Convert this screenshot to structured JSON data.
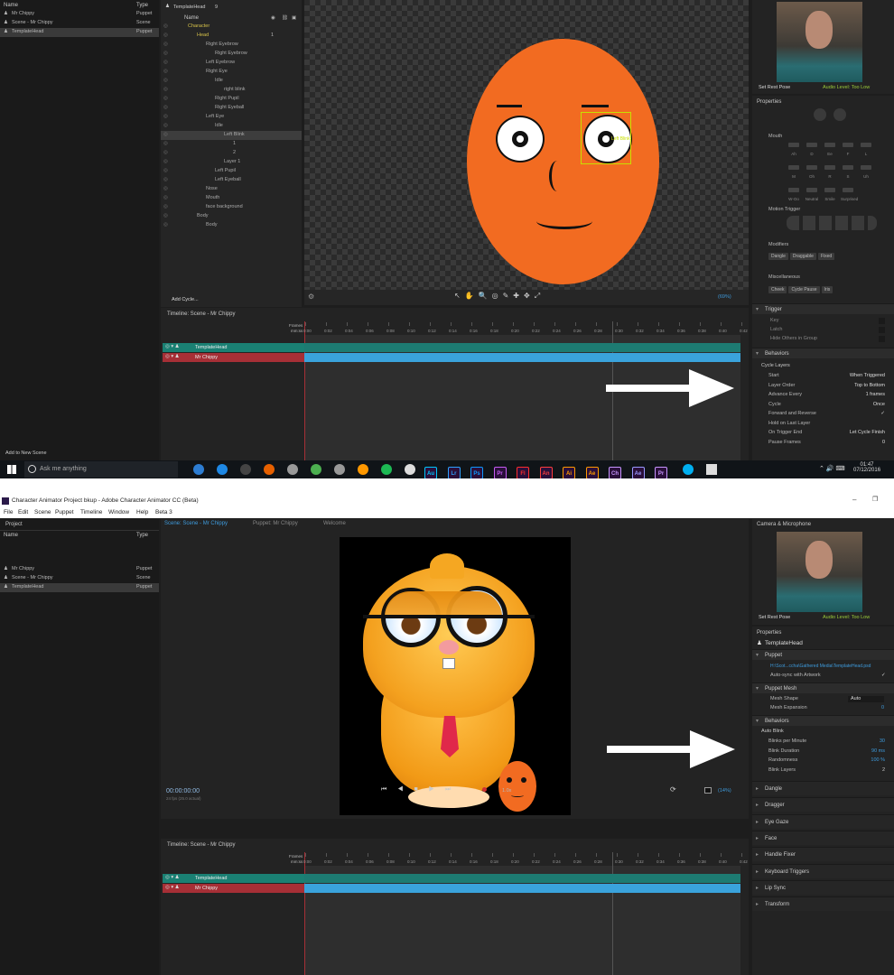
{
  "top": {
    "project": {
      "col_name": "Name",
      "col_type": "Type",
      "items": [
        {
          "name": "Mr Chippy",
          "type": "Puppet"
        },
        {
          "name": "Scene - Mr Chippy",
          "type": "Scene"
        },
        {
          "name": "TemplateHead",
          "type": "Puppet"
        }
      ],
      "add_scene": "Add to New Scene"
    },
    "layers": {
      "header_name": "TemplateHead",
      "header_count": "9",
      "col_name": "Name",
      "add_cycle": "Add Cycle...",
      "items": [
        {
          "label": "Character"
        },
        {
          "label": "Head",
          "num": "1"
        },
        {
          "label": "Right Eyebrow"
        },
        {
          "label": "Right Eyebrow"
        },
        {
          "label": "Left Eyebrow"
        },
        {
          "label": "Right Eye"
        },
        {
          "label": "Idle"
        },
        {
          "label": "right blink"
        },
        {
          "label": "Right Pupil"
        },
        {
          "label": "Right Eyeball"
        },
        {
          "label": "Left Eye"
        },
        {
          "label": "Idle"
        },
        {
          "label": "Left Blink"
        },
        {
          "label": "1"
        },
        {
          "label": "2"
        },
        {
          "label": "Layer 1"
        },
        {
          "label": "Left Pupil"
        },
        {
          "label": "Left Eyeball"
        },
        {
          "label": "Nose"
        },
        {
          "label": "Mouth"
        },
        {
          "label": "face background"
        },
        {
          "label": "Body"
        },
        {
          "label": "Body"
        }
      ]
    },
    "canvas": {
      "selection_label": "Left Blink",
      "zoom": "(69%)"
    },
    "camera": {
      "set_rest_pose": "Set Rest Pose",
      "audio": "Audio Level: Too Low"
    },
    "properties": {
      "title": "Properties",
      "mouth_label": "Mouth",
      "mouth_rows": [
        [
          "Ah",
          "D",
          "Ee",
          "F",
          "L"
        ],
        [
          "M",
          "Oh",
          "R",
          "S",
          "Uh"
        ],
        [
          "W-Oo",
          "Neutral",
          "Smile",
          "Surprised"
        ]
      ],
      "motion_trigger": "Motion Trigger",
      "modifiers_label": "Modifiers",
      "modifiers": [
        "Dangle",
        "Draggable",
        "Fixed"
      ],
      "misc_label": "Miscellaneous",
      "misc": [
        "Cheek",
        "Cycle Pause",
        "Iris"
      ],
      "trigger_section": "Trigger",
      "trigger_rows": [
        "Key",
        "Latch",
        "Hide Others in Group"
      ],
      "behaviors_section": "Behaviors",
      "cycle_layers": "Cycle Layers",
      "cycle_rows": [
        {
          "label": "Start",
          "value": "When Triggered"
        },
        {
          "label": "Layer Order",
          "value": "Top to Bottom"
        },
        {
          "label": "Advance Every",
          "value": "1 frames"
        },
        {
          "label": "Cycle",
          "value": "Once"
        },
        {
          "label": "Forward and Reverse",
          "value": "✓"
        },
        {
          "label": "Hold on Last Layer",
          "value": ""
        },
        {
          "label": "On Trigger End",
          "value": "Let Cycle Finish"
        },
        {
          "label": "Pause Frames",
          "value": "0"
        }
      ]
    },
    "timeline": {
      "title": "Timeline: Scene - Mr Chippy",
      "frames_label": "Frames",
      "time_label": "mm:ss",
      "ticks": [
        "0:00",
        "0:02",
        "0:04",
        "0:06",
        "0:08",
        "0:10",
        "0:12",
        "0:14",
        "0:16",
        "0:18",
        "0:20",
        "0:22",
        "0:24",
        "0:26",
        "0:28",
        "0:30",
        "0:32",
        "0:34",
        "0:36",
        "0:38",
        "0:40",
        "0:42"
      ],
      "tracks": [
        {
          "name": "TemplateHead",
          "color": "#1a8073"
        },
        {
          "name": "Mr Chippy",
          "color": "#a62f36"
        }
      ]
    },
    "taskbar": {
      "search_placeholder": "Ask me anything",
      "time": "01:47",
      "date": "07/12/2016",
      "apps": [
        "Au",
        "Lr",
        "Ps",
        "Pr",
        "Fl",
        "An",
        "Ai",
        "Ae",
        "Ch",
        "Ae",
        "Pr"
      ]
    }
  },
  "bottom": {
    "window_title": "Character Animator Project bkup - Adobe Character Animator CC (Beta)",
    "menu": [
      "File",
      "Edit",
      "Scene",
      "Puppet",
      "Timeline",
      "Window",
      "Help",
      "Beta 3"
    ],
    "project_title": "Project",
    "project": {
      "col_name": "Name",
      "col_type": "Type",
      "items": [
        {
          "name": "Mr Chippy",
          "type": "Puppet"
        },
        {
          "name": "Scene - Mr Chippy",
          "type": "Scene"
        },
        {
          "name": "TemplateHead",
          "type": "Puppet"
        }
      ]
    },
    "tabs": [
      "Scene: Scene - Mr Chippy",
      "Puppet: Mr Chippy",
      "Welcome"
    ],
    "timecode": "00:00:00:00",
    "fps": "24 fps (25.0 actual)",
    "speed": "1.0x",
    "zoom": "(14%)",
    "camera_title": "Camera & Microphone",
    "camera": {
      "set_rest_pose": "Set Rest Pose",
      "audio": "Audio Level: Too Low"
    },
    "properties": {
      "title": "Properties",
      "puppet_name": "TemplateHead",
      "puppet_section": "Puppet",
      "file_path": "H:\\Scot...ccha\\Gathered Media\\TemplateHead.psd",
      "auto_sync": "Auto-sync with Artwork",
      "mesh_section": "Puppet Mesh",
      "mesh_shape_label": "Mesh Shape",
      "mesh_shape": "Auto",
      "mesh_expansion_label": "Mesh Expansion",
      "mesh_expansion": "0",
      "behaviors_section": "Behaviors",
      "auto_blink": "Auto Blink",
      "blink_rows": [
        {
          "label": "Blinks per Minute",
          "value": "30"
        },
        {
          "label": "Blink Duration",
          "value": "90 ms"
        },
        {
          "label": "Randomness",
          "value": "100 %"
        },
        {
          "label": "Blink Layers",
          "value": "2"
        }
      ],
      "collapsed": [
        "Dangle",
        "Dragger",
        "Eye Gaze",
        "Face",
        "Handle Fixer",
        "Keyboard Triggers",
        "Lip Sync",
        "Transform"
      ]
    },
    "timeline": {
      "title": "Timeline: Scene - Mr Chippy",
      "tracks": [
        {
          "name": "TemplateHead",
          "color": "#1a8073"
        },
        {
          "name": "Mr Chippy",
          "color": "#a62f36"
        }
      ]
    }
  },
  "colors": {
    "face": "#f26b21",
    "track_blue": "#3aa3dc",
    "accent": "#3e9bdd"
  }
}
